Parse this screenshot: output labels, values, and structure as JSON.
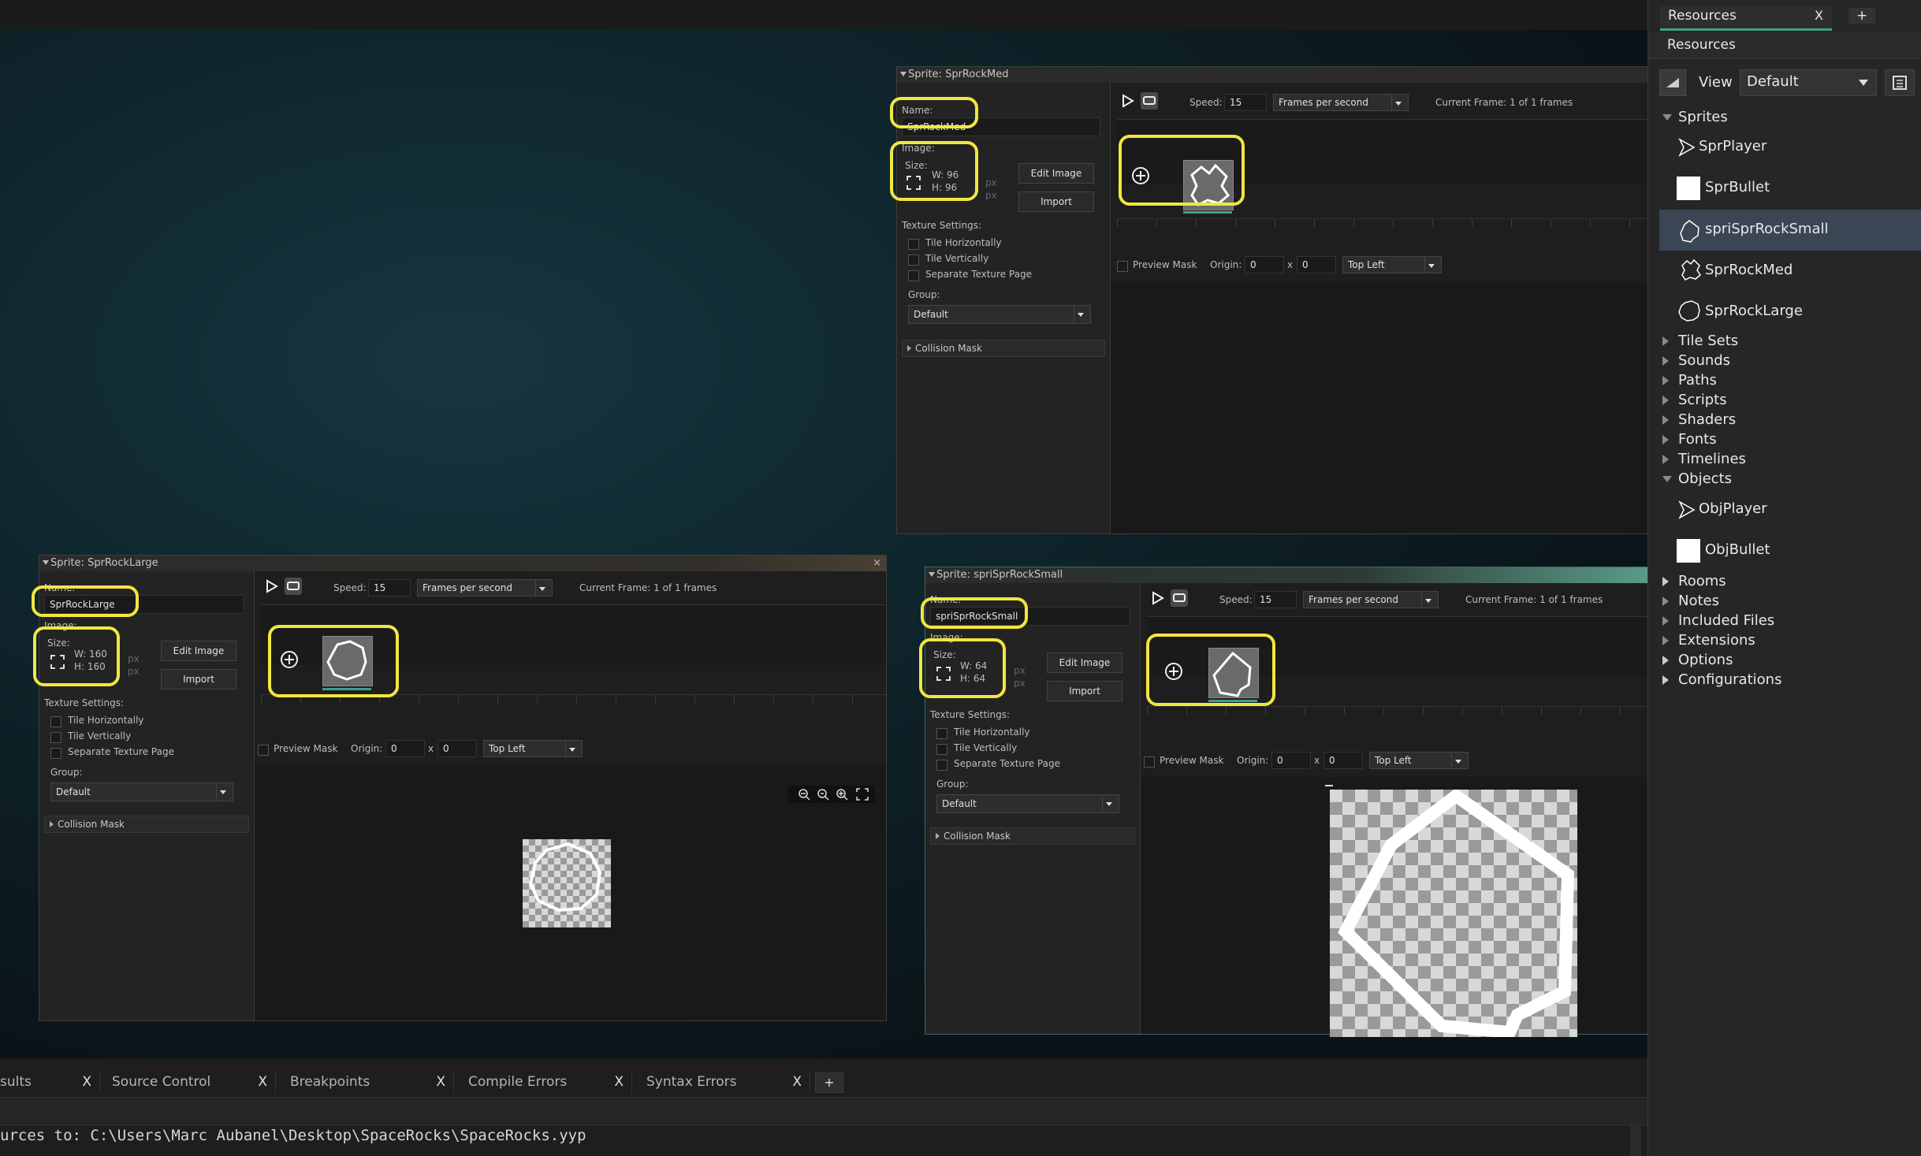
{
  "resources": {
    "tab_label": "Resources",
    "tab_close": "X",
    "tab_add": "+",
    "header": "Resources",
    "view_label": "View",
    "view_value": "Default",
    "sections": {
      "sprites": "Sprites",
      "tile_sets": "Tile Sets",
      "sounds": "Sounds",
      "paths": "Paths",
      "scripts": "Scripts",
      "shaders": "Shaders",
      "fonts": "Fonts",
      "timelines": "Timelines",
      "objects": "Objects",
      "rooms": "Rooms",
      "notes": "Notes",
      "included_files": "Included Files",
      "extensions": "Extensions",
      "options": "Options",
      "configurations": "Configurations"
    },
    "sprites": [
      "SprPlayer",
      "SprBullet",
      "spriSprRockSmall",
      "SprRockMed",
      "SprRockLarge"
    ],
    "objects": [
      "ObjPlayer",
      "ObjBullet"
    ],
    "selected": "spriSprRockSmall"
  },
  "common": {
    "name_label": "Name:",
    "image_label": "Image:",
    "size_label": "Size:",
    "px": "px",
    "edit_image": "Edit Image",
    "import": "Import",
    "texture_settings": "Texture Settings:",
    "tile_h": "Tile Horizontally",
    "tile_v": "Tile Vertically",
    "separate_page": "Separate Texture Page",
    "group_label": "Group:",
    "group_value": "Default",
    "collision_mask": "Collision Mask",
    "speed_label": "Speed:",
    "speed_value": "15",
    "speed_unit": "Frames per second",
    "current_frame": "Current Frame: 1 of 1 frames",
    "preview_mask": "Preview Mask",
    "origin_label": "Origin:",
    "origin_x": "0",
    "origin_sep": "x",
    "origin_y": "0",
    "origin_preset": "Top Left",
    "close": "×"
  },
  "windows": {
    "med": {
      "title": "Sprite: SprRockMed",
      "name": "SprRockMed",
      "w": "W: 96",
      "h": "H: 96"
    },
    "large": {
      "title": "Sprite: SprRockLarge",
      "name": "SprRockLarge",
      "w": "W: 160",
      "h": "H: 160"
    },
    "small": {
      "title": "Sprite: spriSprRockSmall",
      "name": "spriSprRockSmall",
      "w": "W: 64",
      "h": "H: 64"
    }
  },
  "bottom": {
    "tabs": [
      "sults",
      "Source Control",
      "Breakpoints",
      "Compile Errors",
      "Syntax Errors"
    ],
    "tab_close": "X",
    "add": "+",
    "output_line": "urces to: C:\\Users\\Marc Aubanel\\Desktop\\SpaceRocks\\SpaceRocks.yyp"
  },
  "colors": {
    "highlight": "#f2e640",
    "selected_row": "#3b4654"
  }
}
